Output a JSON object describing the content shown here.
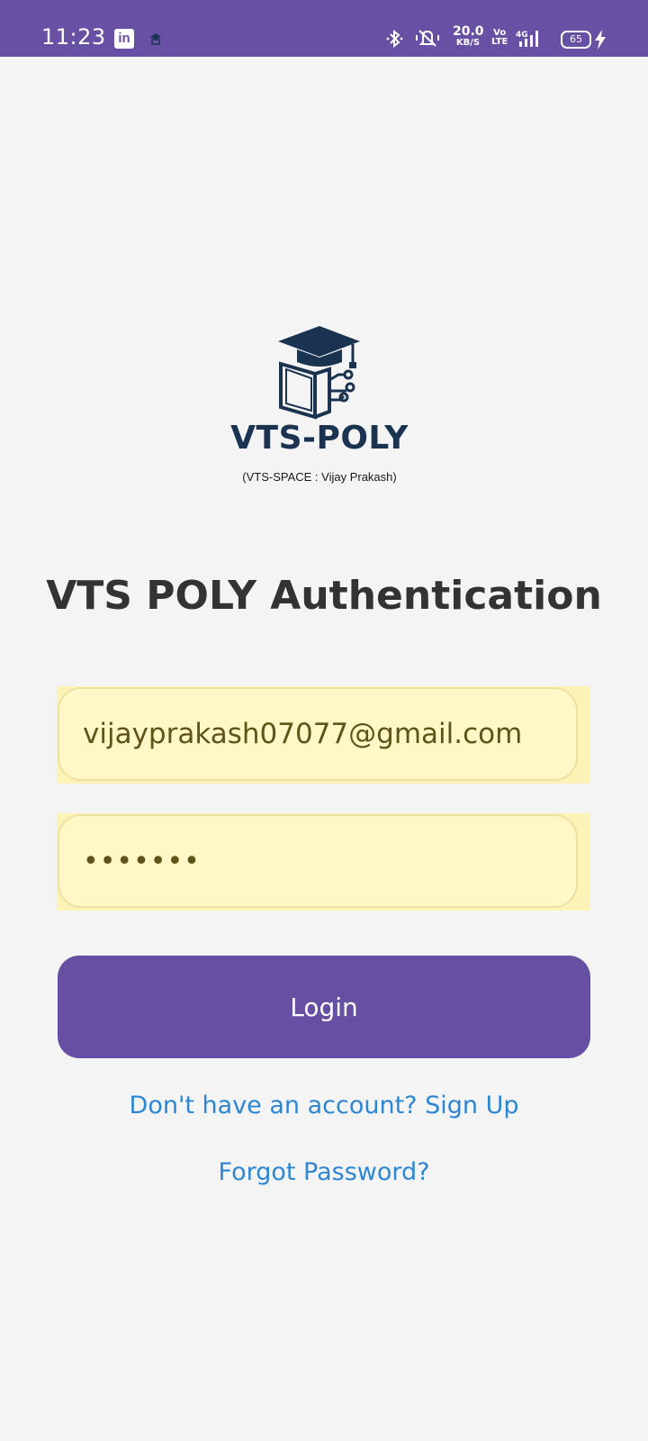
{
  "status_bar": {
    "time": "11:23",
    "linkedin_icon": "linkedin-icon",
    "linkedin_glyph": "in",
    "net_speed": "20.0",
    "net_speed_unit": "KB/S",
    "volte_top": "Vo",
    "volte_bottom": "LTE",
    "network": "4G",
    "battery": "65",
    "background_color": "#6850a4"
  },
  "logo": {
    "name": "VTS-POLY",
    "subtitle": "(VTS-SPACE : Vijay Prakash)",
    "icon": "graduation-cap-book-circuit-icon",
    "color": "#1a3350"
  },
  "auth": {
    "title": "VTS POLY Authentication",
    "email_value": "vijayprakash07077@gmail.com",
    "password_value": "•••••••",
    "login_label": "Login",
    "signup_link": "Don't have an account? Sign Up",
    "forgot_link": "Forgot Password?"
  },
  "colors": {
    "accent": "#6750a4",
    "link": "#2d86d2",
    "field_background": "#fff8c6",
    "page_background": "#f4f4f4"
  }
}
